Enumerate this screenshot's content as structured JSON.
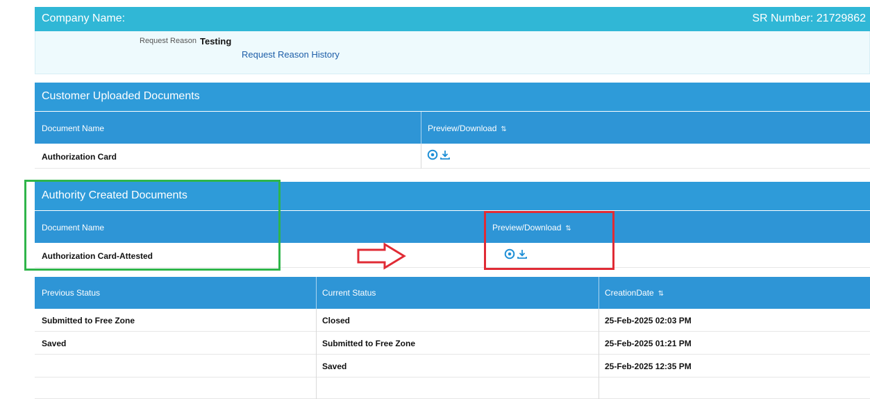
{
  "header": {
    "company_label": "Company Name:",
    "sr_label": "SR Number: 21729862"
  },
  "request": {
    "reason_label": "Request Reason",
    "reason_value": "Testing",
    "history_link": "Request Reason History"
  },
  "customer_docs": {
    "title": "Customer Uploaded Documents",
    "col_name": "Document Name",
    "col_preview": "Preview/Download",
    "rows": [
      {
        "name": "Authorization Card"
      }
    ]
  },
  "authority_docs": {
    "title": "Authority Created Documents",
    "col_name": "Document Name",
    "col_preview": "Preview/Download",
    "rows": [
      {
        "name": "Authorization Card-Attested"
      }
    ]
  },
  "status_table": {
    "col_previous": "Previous Status",
    "col_current": "Current Status",
    "col_date": "CreationDate",
    "rows": [
      {
        "previous": "Submitted to Free Zone",
        "current": "Closed",
        "date": "25-Feb-2025 02:03 PM"
      },
      {
        "previous": "Saved",
        "current": "Submitted to Free Zone",
        "date": "25-Feb-2025 01:21 PM"
      },
      {
        "previous": "",
        "current": "Saved",
        "date": "25-Feb-2025 12:35 PM"
      }
    ]
  },
  "icons": {
    "preview": "eye-icon",
    "download": "download-icon",
    "sort": "sort-icon",
    "arrow": "right-arrow-annotation"
  },
  "colors": {
    "header": "#30b7d6",
    "section": "#2e9bd9",
    "annotation_green": "#2fb54a",
    "annotation_red": "#e02b35"
  }
}
